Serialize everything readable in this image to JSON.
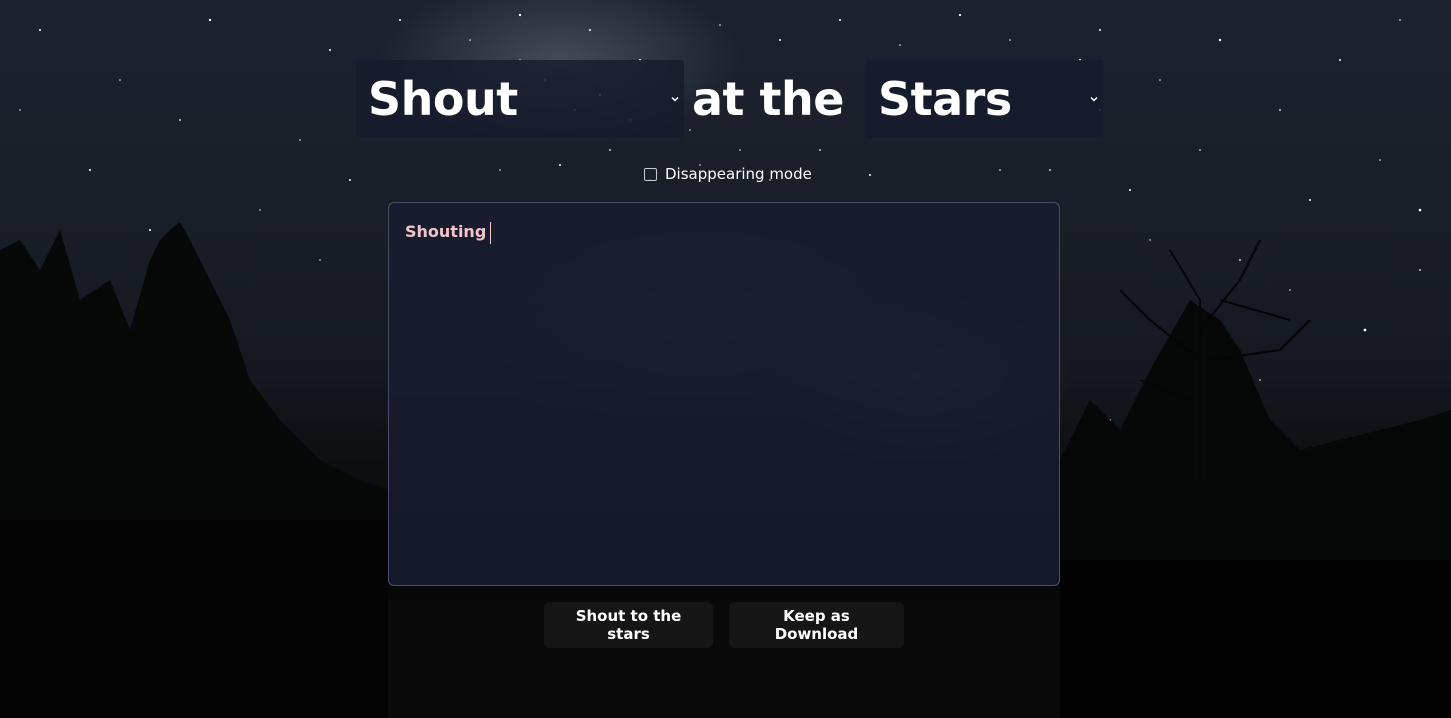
{
  "title": {
    "verb_select": {
      "value": "Shout"
    },
    "middle_text": "at the",
    "object_select": {
      "value": "Stars"
    }
  },
  "disappearing_mode": {
    "label": "Disappearing mode",
    "checked": false
  },
  "editor": {
    "value": "Shouting"
  },
  "actions": {
    "shout_label": "Shout to the stars",
    "keep_label": "Keep as Download"
  },
  "colors": {
    "editor_text": "#f2c3cc",
    "editor_bg": "#181c30",
    "button_bg": "#161616",
    "title_text": "#ffffff"
  },
  "icons": {
    "select_chevron": "chevron-down-icon",
    "checkbox": "checkbox-icon"
  }
}
